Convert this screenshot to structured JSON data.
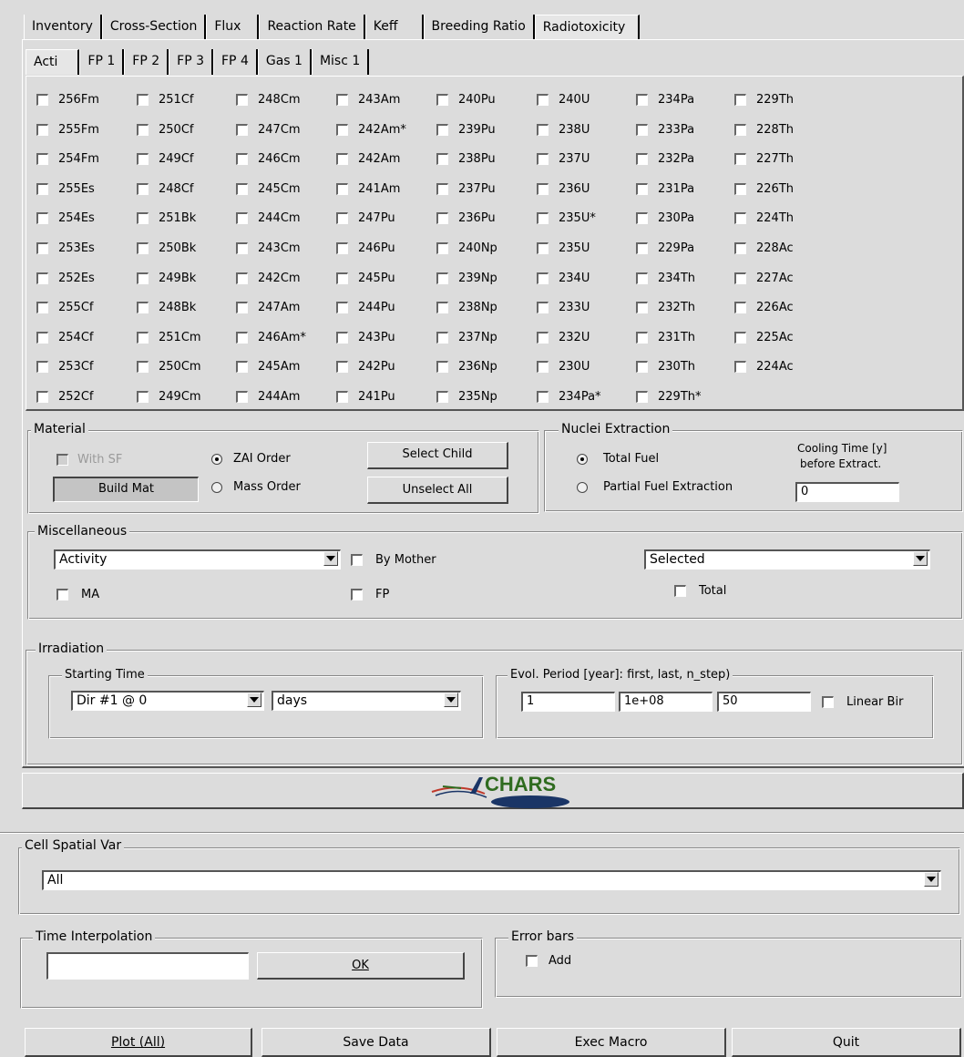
{
  "main_tabs": [
    "Inventory",
    "Cross-Section",
    "Flux",
    "Reaction Rate",
    "Keff",
    "Breeding Ratio",
    "Radiotoxicity"
  ],
  "sub_tabs": [
    "Acti",
    "FP 1",
    "FP 2",
    "FP 3",
    "FP 4",
    "Gas 1",
    "Misc 1"
  ],
  "nuclides": [
    [
      "256Fm",
      "255Fm",
      "254Fm",
      "255Es",
      "254Es",
      "253Es",
      "252Es",
      "255Cf",
      "254Cf",
      "253Cf",
      "252Cf"
    ],
    [
      "251Cf",
      "250Cf",
      "249Cf",
      "248Cf",
      "251Bk",
      "250Bk",
      "249Bk",
      "248Bk",
      "251Cm",
      "250Cm",
      "249Cm"
    ],
    [
      "248Cm",
      "247Cm",
      "246Cm",
      "245Cm",
      "244Cm",
      "243Cm",
      "242Cm",
      "247Am",
      "246Am*",
      "245Am",
      "244Am"
    ],
    [
      "243Am",
      "242Am*",
      "242Am",
      "241Am",
      "247Pu",
      "246Pu",
      "245Pu",
      "244Pu",
      "243Pu",
      "242Pu",
      "241Pu"
    ],
    [
      "240Pu",
      "239Pu",
      "238Pu",
      "237Pu",
      "236Pu",
      "240Np",
      "239Np",
      "238Np",
      "237Np",
      "236Np",
      "235Np"
    ],
    [
      "240U",
      "238U",
      "237U",
      "236U",
      "235U*",
      "235U",
      "234U",
      "233U",
      "232U",
      "230U",
      "234Pa*"
    ],
    [
      "234Pa",
      "233Pa",
      "232Pa",
      "231Pa",
      "230Pa",
      "229Pa",
      "234Th",
      "232Th",
      "231Th",
      "230Th",
      "229Th*"
    ],
    [
      "229Th",
      "228Th",
      "227Th",
      "226Th",
      "224Th",
      "228Ac",
      "227Ac",
      "226Ac",
      "225Ac",
      "224Ac"
    ]
  ],
  "material": {
    "title": "Material",
    "with_sf": "With SF",
    "build_mat": "Build Mat",
    "zai_order": "ZAI Order",
    "mass_order": "Mass Order",
    "select_child": "Select Child",
    "unselect_all": "Unselect All"
  },
  "extraction": {
    "title": "Nuclei Extraction",
    "total_fuel": "Total Fuel",
    "partial": "Partial Fuel Extraction",
    "cooling_label_1": "Cooling Time [y]",
    "cooling_label_2": "before Extract.",
    "cooling_value": "0"
  },
  "misc": {
    "title": "Miscellaneous",
    "quantity": "Activity",
    "by_mother": "By Mother",
    "selection": "Selected",
    "ma": "MA",
    "fp": "FP",
    "total": "Total"
  },
  "irradiation": {
    "title": "Irradiation",
    "starting_time": "Starting Time",
    "dir": "Dir #1 @ 0",
    "unit": "days",
    "evol_title": "Evol. Period [year]: first, last, n_step)",
    "first": "1",
    "last": "1e+08",
    "n_step": "50",
    "linear_bir": "Linear Bir"
  },
  "logo_text": "CHARS",
  "cell_spatial": {
    "title": "Cell Spatial Var",
    "value": "All"
  },
  "time_interp": {
    "title": "Time Interpolation",
    "value": "",
    "ok": "OK"
  },
  "error_bars": {
    "title": "Error bars",
    "add": "Add"
  },
  "bottom": {
    "plot": "Plot (All)",
    "save": "Save Data",
    "exec": "Exec Macro",
    "quit": "Quit"
  },
  "colors": {
    "background": "#dcdcdc",
    "logo_green": "#2f6b1f",
    "logo_navy": "#1a3566",
    "logo_red": "#c0392b"
  }
}
